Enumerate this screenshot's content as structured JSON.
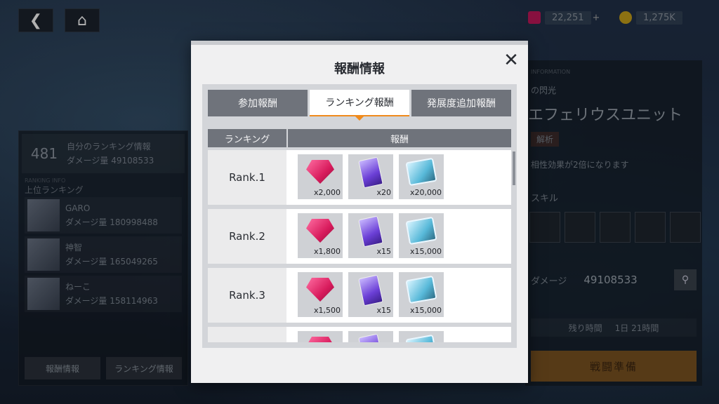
{
  "background": {
    "currency": [
      {
        "icon": "gem-currency-icon",
        "value": "22,251"
      },
      {
        "icon": "coin-currency-icon",
        "value": "1,275K"
      }
    ],
    "my_rank": {
      "rank": "481",
      "label": "自分のランキング情報",
      "damage": "ダメージ量 49108533"
    },
    "top_rank_header": {
      "en": "RANKING INFO",
      "jp": "上位ランキング"
    },
    "top_rankers": [
      {
        "name": "GARO",
        "damage": "ダメージ量 180998488"
      },
      {
        "name": "神智",
        "damage": "ダメージ量 165049265"
      },
      {
        "name": "ねーこ",
        "damage": "ダメージ量 158114963"
      }
    ],
    "left_buttons": [
      "報酬情報",
      "ランキング情報"
    ],
    "right": {
      "info_label": "INFORMATION",
      "sub": "の閃光",
      "unit": "エフェリウスユニット",
      "analysis": "解析",
      "effect": "相性効果が2倍になります",
      "skill_label": "スキル",
      "damage_label": "ダメージ",
      "damage_value": "49108533",
      "time_label": "残り時間",
      "time_value": "1日 21時間",
      "battle_button": "戦闘準備"
    }
  },
  "modal": {
    "title": "報酬情報",
    "close_glyph": "✕",
    "tabs": [
      {
        "label": "参加報酬"
      },
      {
        "label": "ランキング報酬"
      },
      {
        "label": "発展度追加報酬"
      }
    ],
    "active_tab_index": 1,
    "columns": {
      "rank": "ランキング",
      "reward": "報酬"
    },
    "rows": [
      {
        "rank": "Rank.1",
        "items": [
          {
            "icon": "red-gem-icon",
            "qty": "x2,000"
          },
          {
            "icon": "purple-card-icon",
            "qty": "x20"
          },
          {
            "icon": "blue-chip-icon",
            "qty": "x20,000"
          }
        ]
      },
      {
        "rank": "Rank.2",
        "items": [
          {
            "icon": "red-gem-icon",
            "qty": "x1,800"
          },
          {
            "icon": "purple-card-icon",
            "qty": "x15"
          },
          {
            "icon": "blue-chip-icon",
            "qty": "x15,000"
          }
        ]
      },
      {
        "rank": "Rank.3",
        "items": [
          {
            "icon": "red-gem-icon",
            "qty": "x1,500"
          },
          {
            "icon": "purple-card-icon",
            "qty": "x15"
          },
          {
            "icon": "blue-chip-icon",
            "qty": "x15,000"
          }
        ]
      },
      {
        "rank": "",
        "items": [
          {
            "icon": "red-gem-icon",
            "qty": ""
          },
          {
            "icon": "purple-card-icon",
            "qty": ""
          },
          {
            "icon": "blue-chip-icon",
            "qty": ""
          }
        ]
      }
    ]
  }
}
